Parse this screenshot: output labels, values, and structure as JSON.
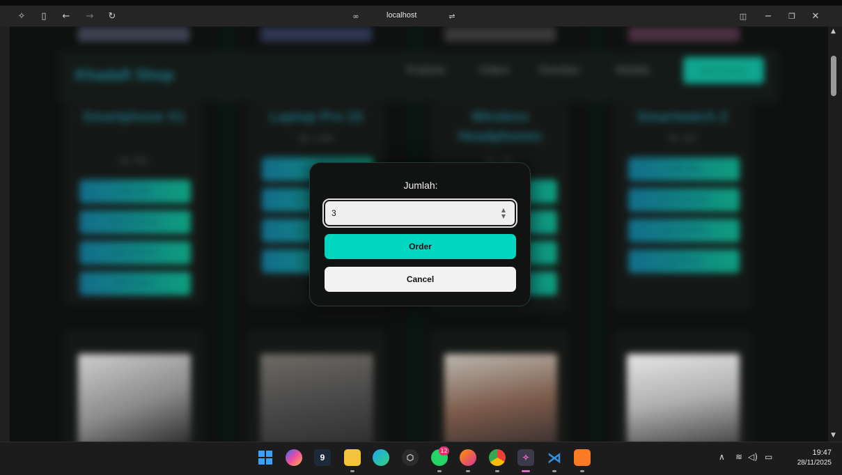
{
  "browser": {
    "url": "localhost"
  },
  "page": {
    "brand": "Khadafi Shop",
    "nav": [
      "Products",
      "Orders",
      "Favorites",
      "Wishlist"
    ],
    "add_product_label": "Add Product",
    "products": [
      {
        "name": "Smartphone X1",
        "price": "Rp. 500"
      },
      {
        "name": "Laptop Pro 15",
        "price": "Rp. 1.000"
      },
      {
        "name": "Wireless Headphones",
        "price": "Rp. 150"
      },
      {
        "name": "Smartwatch Z",
        "price": "Rp. 250"
      }
    ],
    "card_buttons": [
      "Order Now",
      "Add to Favorites",
      "Add to Wishlist",
      "Edit Product"
    ]
  },
  "modal": {
    "label": "Jumlah:",
    "quantity_value": "3",
    "order_label": "Order",
    "cancel_label": "Cancel"
  },
  "taskbar": {
    "whatsapp_badge": "12",
    "time": "19:47",
    "date": "28/11/2025"
  },
  "colors": {
    "accent": "#00d6c0",
    "modal_bg": "#111312"
  }
}
